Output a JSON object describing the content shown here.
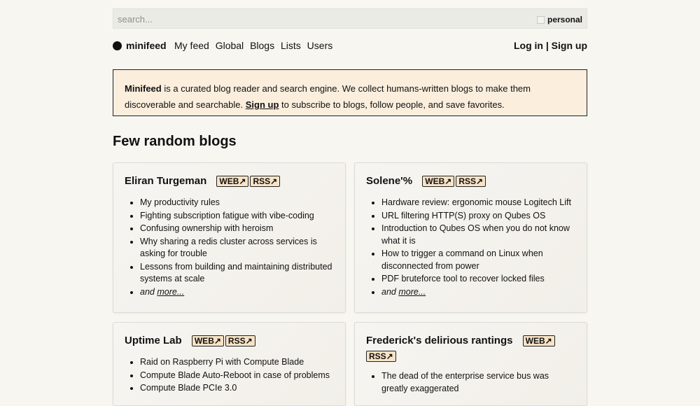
{
  "search": {
    "placeholder": "search...",
    "personal_label": "personal"
  },
  "nav": {
    "brand": "minifeed",
    "links": [
      "My feed",
      "Global",
      "Blogs",
      "Lists",
      "Users"
    ],
    "login": "Log in",
    "separator": "|",
    "signup": "Sign up"
  },
  "intro": {
    "brand": "Minifeed",
    "text1": " is a curated blog reader and search engine. We collect humans-written blogs to make them discoverable and searchable. ",
    "signup": "Sign up",
    "text2": " to subscribe to blogs, follow people, and save favorites."
  },
  "section_title": "Few random blogs",
  "blogs": [
    {
      "title": "Eliran Turgeman",
      "web": "WEB↗",
      "rss": "RSS↗",
      "posts": [
        "My productivity rules",
        "Fighting subscription fatigue with vibe-coding",
        "Confusing ownership with heroism",
        "Why sharing a redis cluster across services is asking for trouble",
        "Lessons from building and maintaining distributed systems at scale"
      ],
      "and": "and ",
      "more": "more..."
    },
    {
      "title": "Solene'%",
      "web": "WEB↗",
      "rss": "RSS↗",
      "posts": [
        "Hardware review: ergonomic mouse Logitech Lift",
        "URL filtering HTTP(S) proxy on Qubes OS",
        "Introduction to Qubes OS when you do not know what it is",
        "How to trigger a command on Linux when disconnected from power",
        "PDF bruteforce tool to recover locked files"
      ],
      "and": "and ",
      "more": "more..."
    },
    {
      "title": "Uptime Lab",
      "web": "WEB↗",
      "rss": "RSS↗",
      "posts": [
        "Raid on Raspberry Pi with Compute Blade",
        "Compute Blade Auto-Reboot in case of problems",
        "Compute Blade PCIe 3.0"
      ]
    },
    {
      "title": "Frederick's delirious rantings",
      "web": "WEB↗",
      "rss": "RSS↗",
      "posts": [
        "The dead of the enterprise service bus was greatly exaggerated"
      ]
    }
  ],
  "colors": {
    "background": "#f7f6f1",
    "intro_bg": "#fbeedd",
    "badge_bg": "#f7e3c6"
  }
}
